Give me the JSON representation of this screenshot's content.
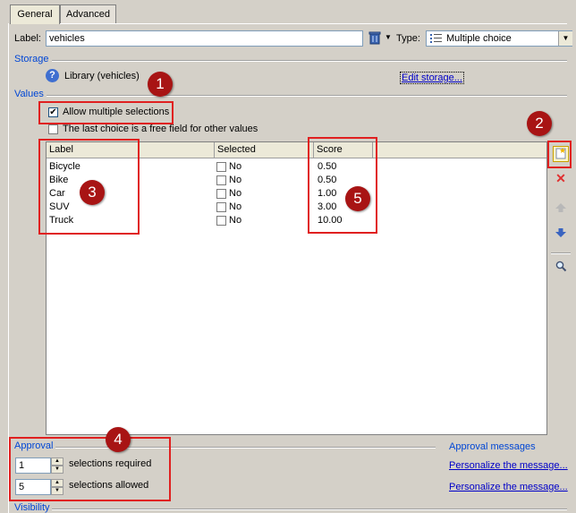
{
  "tabs": [
    {
      "label": "General"
    },
    {
      "label": "Advanced"
    }
  ],
  "label_field": {
    "caption": "Label:",
    "value": "vehicles"
  },
  "type_field": {
    "caption": "Type:",
    "value": "Multiple choice"
  },
  "storage": {
    "title": "Storage",
    "library_text": "Library (vehicles)",
    "edit_link": "Edit storage..."
  },
  "values": {
    "title": "Values",
    "allow_multiple_label": "Allow multiple selections",
    "allow_multiple_checked": true,
    "free_field_label": "The last choice is a free field for other values",
    "free_field_checked": false,
    "columns": [
      "Label",
      "Selected",
      "Score"
    ],
    "rows": [
      {
        "label": "Bicycle",
        "selected": "No",
        "score": "0.50"
      },
      {
        "label": "Bike",
        "selected": "No",
        "score": "0.50"
      },
      {
        "label": "Car",
        "selected": "No",
        "score": "1.00"
      },
      {
        "label": "SUV",
        "selected": "No",
        "score": "3.00"
      },
      {
        "label": "Truck",
        "selected": "No",
        "score": "10.00"
      }
    ]
  },
  "approval": {
    "title": "Approval",
    "required_value": "1",
    "required_label": "selections required",
    "allowed_value": "5",
    "allowed_label": "selections allowed"
  },
  "approval_messages": {
    "title": "Approval messages",
    "link1": "Personalize the message...",
    "link2": "Personalize the message..."
  },
  "visibility": {
    "title": "Visibility"
  },
  "markers": [
    "1",
    "2",
    "3",
    "4",
    "5"
  ],
  "colors": {
    "accent_link": "#0000c8",
    "section_title": "#0046d5",
    "highlight": "#e02020",
    "marker": "#a81414"
  }
}
